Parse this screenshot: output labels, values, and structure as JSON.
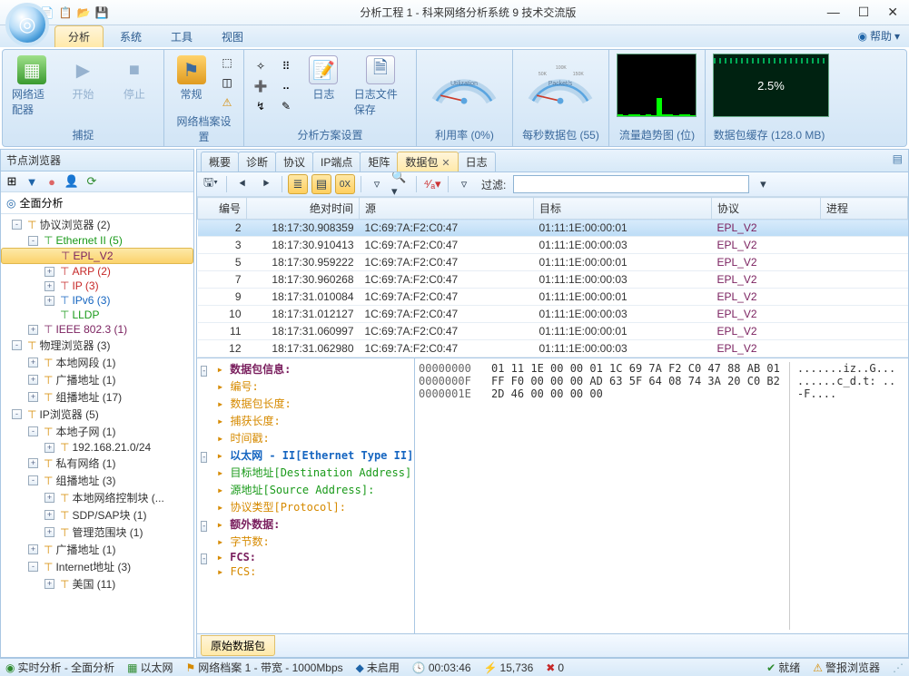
{
  "window": {
    "title": "分析工程 1 - 科来网络分析系统 9 技术交流版",
    "min": "—",
    "max": "☐",
    "close": "✕"
  },
  "help_label": "帮助",
  "ribbon_tabs": [
    "分析",
    "系统",
    "工具",
    "视图"
  ],
  "ribbon": {
    "groups": {
      "capture": {
        "label": "捕捉",
        "adapter": "网络适配器",
        "start": "开始",
        "stop": "停止"
      },
      "profile": {
        "label": "网络档案设置",
        "general": "常规"
      },
      "scheme": {
        "label": "分析方案设置",
        "log": "日志",
        "savefile": "日志文件保存"
      },
      "util": {
        "label": "利用率 (0%)",
        "gauge": "Utilization"
      },
      "pps": {
        "label": "每秒数据包 (55)",
        "gauge": "Packet/s"
      },
      "trend": {
        "label": "流量趋势图 (位)"
      },
      "buffer": {
        "label": "数据包缓存 (128.0 MB)",
        "value": "2.5%"
      }
    }
  },
  "left": {
    "title": "节点浏览器",
    "full": "全面分析",
    "tree": [
      {
        "indent": 0,
        "toggle": "-",
        "label": "协议浏览器 (2)",
        "cls": ""
      },
      {
        "indent": 1,
        "toggle": "-",
        "label": "Ethernet II (5)",
        "cls": "c-green"
      },
      {
        "indent": 2,
        "toggle": "",
        "label": "EPL_V2",
        "cls": "c-maroon",
        "sel": true
      },
      {
        "indent": 2,
        "toggle": "+",
        "label": "ARP (2)",
        "cls": "c-red"
      },
      {
        "indent": 2,
        "toggle": "+",
        "label": "IP (3)",
        "cls": "c-red"
      },
      {
        "indent": 2,
        "toggle": "+",
        "label": "IPv6 (3)",
        "cls": "c-blue"
      },
      {
        "indent": 2,
        "toggle": "",
        "label": "LLDP",
        "cls": "c-green"
      },
      {
        "indent": 1,
        "toggle": "+",
        "label": "IEEE 802.3 (1)",
        "cls": "c-maroon"
      },
      {
        "indent": 0,
        "toggle": "-",
        "label": "物理浏览器 (3)",
        "cls": ""
      },
      {
        "indent": 1,
        "toggle": "+",
        "label": "本地网段 (1)",
        "cls": ""
      },
      {
        "indent": 1,
        "toggle": "+",
        "label": "广播地址 (1)",
        "cls": ""
      },
      {
        "indent": 1,
        "toggle": "+",
        "label": "组播地址 (17)",
        "cls": ""
      },
      {
        "indent": 0,
        "toggle": "-",
        "label": "IP浏览器 (5)",
        "cls": ""
      },
      {
        "indent": 1,
        "toggle": "-",
        "label": "本地子网 (1)",
        "cls": ""
      },
      {
        "indent": 2,
        "toggle": "+",
        "label": "192.168.21.0/24",
        "cls": ""
      },
      {
        "indent": 1,
        "toggle": "+",
        "label": "私有网络 (1)",
        "cls": ""
      },
      {
        "indent": 1,
        "toggle": "-",
        "label": "组播地址 (3)",
        "cls": ""
      },
      {
        "indent": 2,
        "toggle": "+",
        "label": "本地网络控制块 (...",
        "cls": ""
      },
      {
        "indent": 2,
        "toggle": "+",
        "label": "SDP/SAP块 (1)",
        "cls": ""
      },
      {
        "indent": 2,
        "toggle": "+",
        "label": "管理范围块 (1)",
        "cls": ""
      },
      {
        "indent": 1,
        "toggle": "+",
        "label": "广播地址 (1)",
        "cls": ""
      },
      {
        "indent": 1,
        "toggle": "-",
        "label": "Internet地址 (3)",
        "cls": ""
      },
      {
        "indent": 2,
        "toggle": "+",
        "label": "美国 (11)",
        "cls": ""
      }
    ]
  },
  "tabs": [
    "概要",
    "诊断",
    "协议",
    "IP端点",
    "矩阵",
    "数据包",
    "日志"
  ],
  "active_tab": 5,
  "filter_label": "过滤:",
  "columns": [
    "编号",
    "绝对时间",
    "源",
    "目标",
    "协议",
    "进程"
  ],
  "rows": [
    {
      "no": "2",
      "time": "18:17:30.908359",
      "src": "1C:69:7A:F2:C0:47",
      "dst": "01:11:1E:00:00:01",
      "proto": "EPL_V2",
      "proc": "",
      "sel": true
    },
    {
      "no": "3",
      "time": "18:17:30.910413",
      "src": "1C:69:7A:F2:C0:47",
      "dst": "01:11:1E:00:00:03",
      "proto": "EPL_V2",
      "proc": ""
    },
    {
      "no": "5",
      "time": "18:17:30.959222",
      "src": "1C:69:7A:F2:C0:47",
      "dst": "01:11:1E:00:00:01",
      "proto": "EPL_V2",
      "proc": ""
    },
    {
      "no": "7",
      "time": "18:17:30.960268",
      "src": "1C:69:7A:F2:C0:47",
      "dst": "01:11:1E:00:00:03",
      "proto": "EPL_V2",
      "proc": ""
    },
    {
      "no": "9",
      "time": "18:17:31.010084",
      "src": "1C:69:7A:F2:C0:47",
      "dst": "01:11:1E:00:00:01",
      "proto": "EPL_V2",
      "proc": ""
    },
    {
      "no": "10",
      "time": "18:17:31.012127",
      "src": "1C:69:7A:F2:C0:47",
      "dst": "01:11:1E:00:00:03",
      "proto": "EPL_V2",
      "proc": ""
    },
    {
      "no": "11",
      "time": "18:17:31.060997",
      "src": "1C:69:7A:F2:C0:47",
      "dst": "01:11:1E:00:00:01",
      "proto": "EPL_V2",
      "proc": ""
    },
    {
      "no": "12",
      "time": "18:17:31.062980",
      "src": "1C:69:7A:F2:C0:47",
      "dst": "01:11:1E:00:00:03",
      "proto": "EPL_V2",
      "proc": ""
    }
  ],
  "detail": [
    {
      "indent": 0,
      "toggle": "-",
      "label": "数据包信息:",
      "cls": "c-maroon",
      "bold": true
    },
    {
      "indent": 1,
      "toggle": "",
      "label": "编号:",
      "cls": "ico-orange"
    },
    {
      "indent": 1,
      "toggle": "",
      "label": "数据包长度:",
      "cls": "ico-orange"
    },
    {
      "indent": 1,
      "toggle": "",
      "label": "捕获长度:",
      "cls": "ico-orange"
    },
    {
      "indent": 1,
      "toggle": "",
      "label": "时间戳:",
      "cls": "ico-orange"
    },
    {
      "indent": 0,
      "toggle": "-",
      "label": "以太网 - II[Ethernet Type II]",
      "cls": "c-blue",
      "bold": true
    },
    {
      "indent": 1,
      "toggle": "",
      "label": "目标地址[Destination Address]:",
      "cls": "c-green"
    },
    {
      "indent": 1,
      "toggle": "",
      "label": "源地址[Source Address]:",
      "cls": "c-green"
    },
    {
      "indent": 1,
      "toggle": "",
      "label": "协议类型[Protocol]:",
      "cls": "ico-orange"
    },
    {
      "indent": 0,
      "toggle": "-",
      "label": "额外数据:",
      "cls": "c-maroon",
      "bold": true
    },
    {
      "indent": 1,
      "toggle": "",
      "label": "字节数:",
      "cls": "ico-orange"
    },
    {
      "indent": 0,
      "toggle": "-",
      "label": "FCS:",
      "cls": "c-maroon",
      "bold": true
    },
    {
      "indent": 1,
      "toggle": "",
      "label": "FCS:",
      "cls": "ico-orange"
    }
  ],
  "hex": {
    "offsets": "00000000\n0000000F\n0000001E",
    "bytes": "01 11 1E 00 00 01 1C 69 7A F2 C0 47 88 AB 01\nFF F0 00 00 00 AD 63 5F 64 08 74 3A 20 C0 B2\n2D 46 00 00 00 00",
    "ascii": ".......iz..G...\n......c_d.t: ..\n-F...."
  },
  "bottom_tab": "原始数据包",
  "status": {
    "realtime": "实时分析 - 全面分析",
    "eth": "以太网",
    "profile": "网络档案 1 - 带宽 - 1000Mbps",
    "disabled": "未启用",
    "duration": "00:03:46",
    "packets": "15,736",
    "zero": "0",
    "ready": "就绪",
    "alarm": "警报浏览器"
  }
}
